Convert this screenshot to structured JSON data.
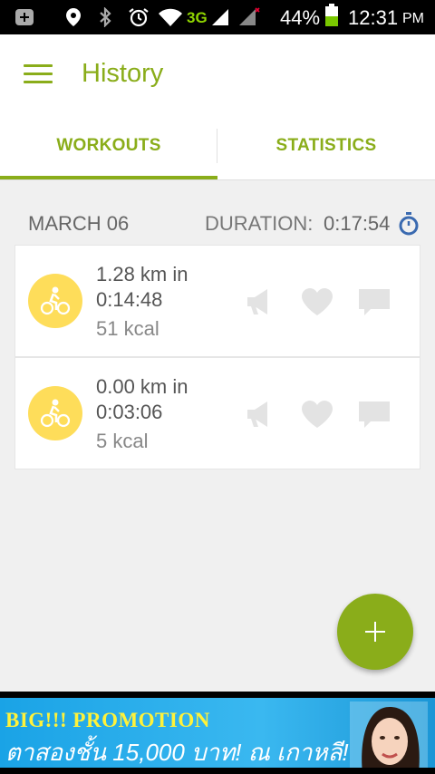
{
  "status_bar": {
    "battery": "44%",
    "time": "12:31",
    "ampm": "PM",
    "network": "3G",
    "icons": [
      "notification-icon",
      "location-icon",
      "bluetooth-icon",
      "alarm-icon",
      "wifi-icon",
      "signal-icon",
      "signal-2-icon",
      "battery-icon"
    ]
  },
  "app_bar": {
    "title": "History",
    "accent_color": "#8aad1a"
  },
  "tabs": [
    {
      "label": "WORKOUTS",
      "selected": true
    },
    {
      "label": "STATISTICS",
      "selected": false
    }
  ],
  "section": {
    "date": "MARCH 06",
    "duration_label": "DURATION:",
    "duration_value": "0:17:54"
  },
  "workouts": [
    {
      "distance": "1.28 km in",
      "time": "0:14:48",
      "kcal": "51 kcal",
      "activity_icon": "cycling-icon"
    },
    {
      "distance": "0.00 km in",
      "time": "0:03:06",
      "kcal": "5 kcal",
      "activity_icon": "cycling-icon"
    }
  ],
  "fab": {
    "icon": "plus-icon"
  },
  "ad": {
    "line1": "BIG!!! PROMOTION",
    "line2": "ตาสองชั้น 15,000 บาท! ณ เกาหลี!"
  }
}
